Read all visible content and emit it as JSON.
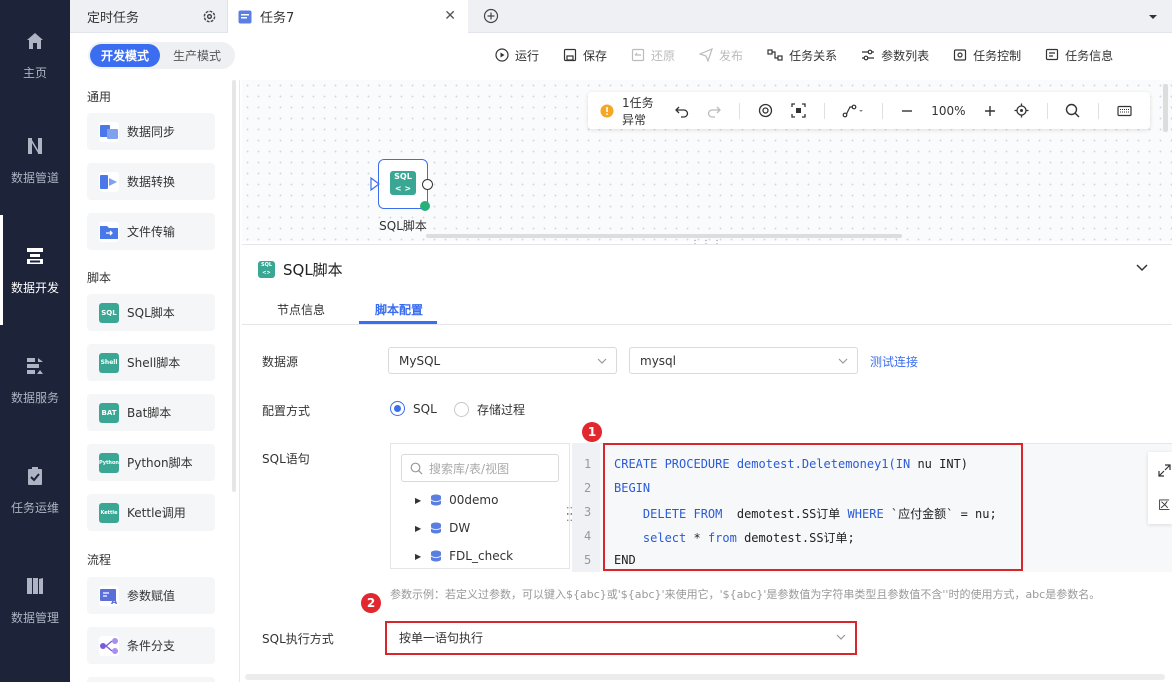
{
  "nav": {
    "items": [
      {
        "label": "主页",
        "icon": "home-icon"
      },
      {
        "label": "数据管道",
        "icon": "pipeline-icon"
      },
      {
        "label": "数据开发",
        "icon": "dev-icon"
      },
      {
        "label": "数据服务",
        "icon": "service-icon"
      },
      {
        "label": "任务运维",
        "icon": "ops-icon"
      },
      {
        "label": "数据管理",
        "icon": "manage-icon"
      }
    ]
  },
  "tabs": {
    "tab1": "定时任务",
    "tab2": "任务7"
  },
  "mode": {
    "dev": "开发模式",
    "prod": "生产模式"
  },
  "toolbar": {
    "run": "运行",
    "save": "保存",
    "restore": "还原",
    "publish": "发布",
    "relation": "任务关系",
    "params": "参数列表",
    "control": "任务控制",
    "info": "任务信息"
  },
  "palette": {
    "section_general": "通用",
    "section_script": "脚本",
    "section_flow": "流程",
    "items": {
      "sync": "数据同步",
      "transform": "数据转换",
      "file": "文件传输",
      "sql": "SQL脚本",
      "shell": "Shell脚本",
      "bat": "Bat脚本",
      "python": "Python脚本",
      "kettle": "Kettle调用",
      "assign": "参数赋值",
      "branch": "条件分支"
    },
    "icon_text": {
      "sql": "SQL",
      "shell": "Shell",
      "bat": "BAT",
      "python": "Python",
      "kettle": "Kettle"
    }
  },
  "canvas": {
    "warning": "1任务异常",
    "zoom": "100%",
    "node_label": "SQL脚本",
    "node_icon_text": "SQL"
  },
  "panel": {
    "title": "SQL脚本",
    "tab_node": "节点信息",
    "tab_script": "脚本配置",
    "label_datasource": "数据源",
    "datasource_type": "MySQL",
    "datasource_name": "mysql",
    "test_conn": "测试连接",
    "label_config": "配置方式",
    "radio_sql": "SQL",
    "radio_proc": "存储过程",
    "label_sql": "SQL语句",
    "search_placeholder": "搜索库/表/视图",
    "tree": [
      "00demo",
      "DW",
      "FDL_check"
    ],
    "code_lines": [
      "1",
      "2",
      "3",
      "4",
      "5"
    ],
    "hint": "参数示例：若定义过参数，可以键入${abc}或'${abc}'来使用它，'${abc}'是参数值为字符串类型且参数值不含''时的使用方式，abc是参数名。",
    "label_exec": "SQL执行方式",
    "exec_mode": "按单一语句执行",
    "badge1": "1",
    "badge2": "2",
    "side_tool_text": "区"
  },
  "code": {
    "l1a": "CREATE PROCEDURE demotest.Deletemoney1(",
    "l1b": "IN",
    "l1c": " nu INT)",
    "l2": "BEGIN",
    "l3a": "    ",
    "l3b": "DELETE FROM",
    "l3c": "  demotest.SS订单 ",
    "l3d": "WHERE",
    "l3e": " `应付金额` = nu;",
    "l4a": "    ",
    "l4b": "select",
    "l4c": " * ",
    "l4d": "from",
    "l4e": " demotest.SS订单;",
    "l5": "END"
  },
  "colors": {
    "accent": "#3a6df0",
    "nav_bg": "#1d2338",
    "highlight": "#d8262d"
  }
}
